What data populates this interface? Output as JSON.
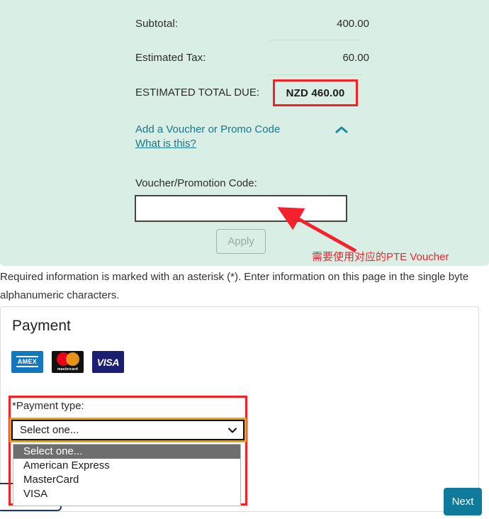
{
  "summary": {
    "rows": [
      {
        "label": "Subtotal:",
        "value": "400.00"
      },
      {
        "label": "Estimated Tax:",
        "value": "60.00"
      }
    ],
    "total_label": "ESTIMATED TOTAL DUE:",
    "total_value": "NZD 460.00",
    "highlight_color": "#fa2020"
  },
  "voucher": {
    "toggle_label": "Add a Voucher or Promo Code",
    "toggle_icon": "chevron-up-icon",
    "what_is_this": "What is this?",
    "field_label": "Voucher/Promotion Code:",
    "input_value": "",
    "input_placeholder": "",
    "apply_label": "Apply",
    "apply_disabled": true,
    "link_color": "#17788d"
  },
  "annotation": {
    "arrow": "red-arrow",
    "note": "需要使用对应的PTE Voucher",
    "color": "#f5222d"
  },
  "required_note": "Required information is marked with an asterisk (*). Enter information on this page in the single byte alphanumeric characters.",
  "payment": {
    "title": "Payment",
    "accepted_cards": [
      {
        "name": "amex-logo",
        "text": "AMEX"
      },
      {
        "name": "mastercard-logo",
        "text": "mastercard"
      },
      {
        "name": "visa-logo",
        "text": "VISA"
      }
    ],
    "payment_type": {
      "label": "*Payment type:",
      "selected": "Select one...",
      "options": [
        "Select one...",
        "American Express",
        "MasterCard",
        "VISA"
      ],
      "focus_ring_color": "#f0a202",
      "highlight_color": "#fa2020"
    }
  },
  "footer": {
    "next_label": "Next",
    "next_color": "#0f7b9c"
  }
}
